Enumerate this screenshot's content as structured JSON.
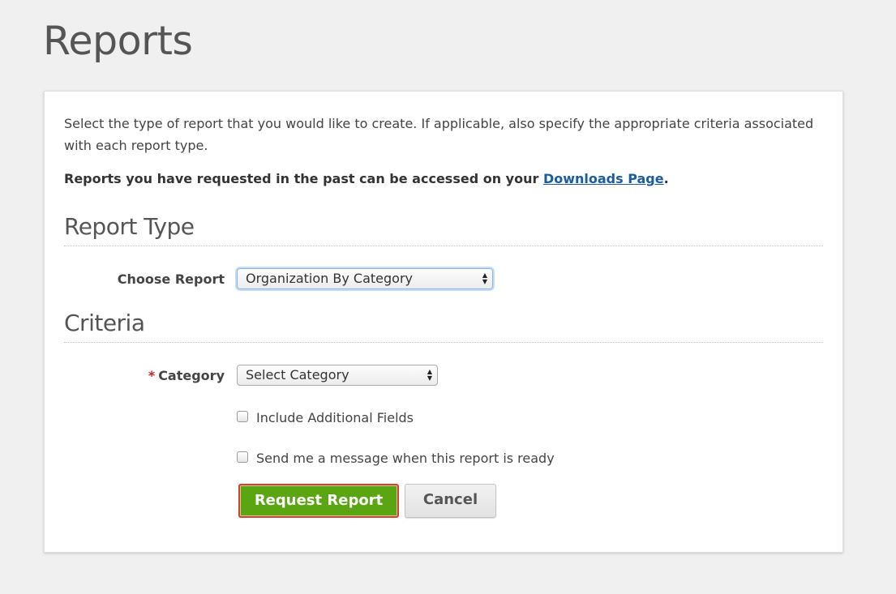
{
  "page": {
    "title": "Reports"
  },
  "intro": {
    "description": "Select the type of report that you would like to create. If applicable, also specify the appropriate criteria associated with each report type.",
    "past_reports_text": "Reports you have requested in the past can be accessed on your ",
    "downloads_link": "Downloads Page",
    "past_reports_suffix": "."
  },
  "report_type": {
    "heading": "Report Type",
    "choose_label": "Choose Report",
    "selected": "Organization By Category"
  },
  "criteria": {
    "heading": "Criteria",
    "required_marker": "*",
    "category_label": "Category",
    "category_selected": "Select Category",
    "include_fields_label": "Include Additional Fields",
    "include_fields_checked": false,
    "notify_label": "Send me a message when this report is ready",
    "notify_checked": false
  },
  "actions": {
    "request_label": "Request Report",
    "cancel_label": "Cancel"
  },
  "colors": {
    "primary_button": "#5aa512",
    "highlight_border": "#e03a2a",
    "link": "#1a5c9e",
    "required": "#cc2222"
  },
  "icons": {
    "select_arrows": "up-down-caret-icon"
  }
}
